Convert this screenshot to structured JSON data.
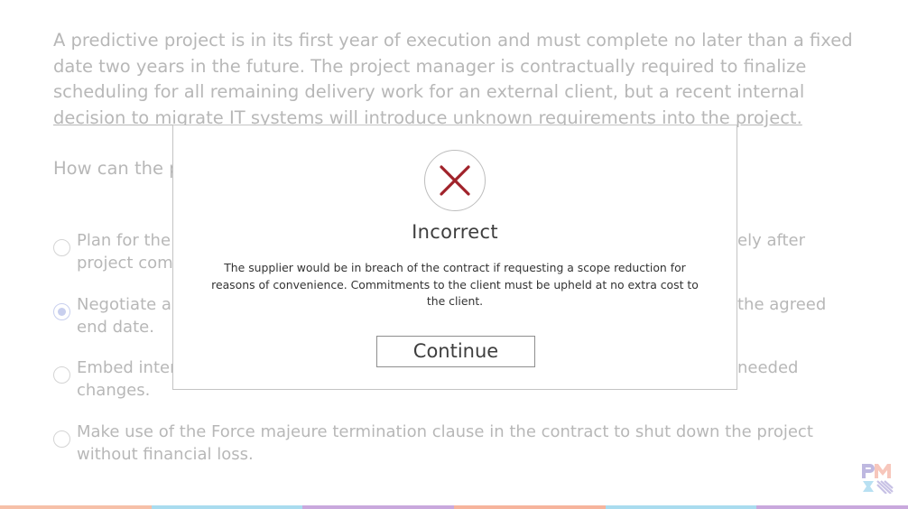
{
  "question": {
    "stem_lines": [
      "A predictive project is in its first year of execution and must complete no later than a fixed",
      "date two years in the future. The project manager is contractually required to finalize",
      "scheduling for all remaining delivery work for an external client, but a recent internal",
      "decision to migrate IT systems will introduce unknown requirements into the project."
    ],
    "prompt_visible": "How can the p",
    "options": [
      {
        "lines": [
          "Plan for the",
          "project comp"
        ],
        "right_fragment": "ely after",
        "selected": false
      },
      {
        "lines": [
          "Negotiate a",
          "end date."
        ],
        "right_fragment": "the agreed",
        "selected": true
      },
      {
        "lines": [
          "Embed inter",
          "changes."
        ],
        "right_fragment": "needed",
        "selected": false
      },
      {
        "lines": [
          "Make use of the Force majeure termination clause in the contract to shut down the project",
          "without financial loss."
        ],
        "right_fragment": "",
        "selected": false
      }
    ]
  },
  "dialog": {
    "icon": "x-mark-icon",
    "title": "Incorrect",
    "feedback_lines": [
      "The supplier would be in breach of the contract if requesting a scope reduction for",
      "reasons of convenience. Commitments to the client must be upheld at no extra cost to",
      "the client."
    ],
    "continue_label": "Continue"
  },
  "colors": {
    "icon_red": "#a0222a",
    "radio_selected": "#7d8fd8",
    "bar_segments": [
      "#f6c0a8",
      "#a9dcef",
      "#c9a8dd",
      "#f6b49c",
      "#a9dcef",
      "#c9a8dd"
    ]
  },
  "logo": {
    "icon": "pmi-logo-icon"
  }
}
